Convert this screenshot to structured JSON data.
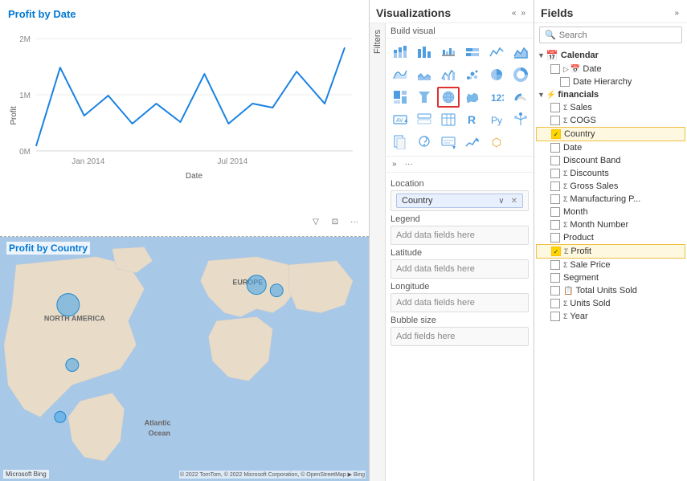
{
  "leftPanel": {
    "chart": {
      "title": "Profit by Date",
      "yLabel": "Profit",
      "xLabel": "Date",
      "xTicks": [
        "Jan 2014",
        "Jul 2014"
      ],
      "yTicks": [
        "2M",
        "1M",
        "0M"
      ]
    },
    "map": {
      "title": "Profit by Country",
      "bingLogo": "Microsoft Bing",
      "copyright": "© 2022 TomTom, © 2022 Microsoft Corporation, © OpenStreetMap ▶ Bing"
    }
  },
  "vizPanel": {
    "title": "Visualizations",
    "filtersLabel": "Filters",
    "buildVisualLabel": "Build visual",
    "tabs": [
      {
        "label": "Build visual",
        "active": true
      }
    ],
    "sections": [
      {
        "label": "Location",
        "fields": [
          {
            "value": "Country",
            "hasChip": true
          }
        ]
      },
      {
        "label": "Legend",
        "fields": [
          {
            "placeholder": "Add data fields here",
            "hasChip": false
          }
        ]
      },
      {
        "label": "Latitude",
        "fields": [
          {
            "placeholder": "Add data fields here",
            "hasChip": false
          }
        ]
      },
      {
        "label": "Longitude",
        "fields": [
          {
            "placeholder": "Add data fields here",
            "hasChip": false
          }
        ]
      },
      {
        "label": "Bubble size",
        "fields": [
          {
            "placeholder": "Add fields here",
            "hasChip": false
          }
        ]
      }
    ]
  },
  "fieldsPanel": {
    "title": "Fields",
    "searchPlaceholder": "Search",
    "groups": [
      {
        "name": "Calendar",
        "icon": "📅",
        "expanded": true,
        "items": [
          {
            "name": "Date",
            "typeIcon": "",
            "checked": false,
            "indent": 1,
            "hasExpand": true
          },
          {
            "name": "Date Hierarchy",
            "typeIcon": "",
            "checked": false,
            "indent": 2
          }
        ]
      },
      {
        "name": "financials",
        "icon": "⚡",
        "expanded": true,
        "items": [
          {
            "name": "Sales",
            "typeIcon": "Σ",
            "checked": false,
            "indent": 1
          },
          {
            "name": "COGS",
            "typeIcon": "Σ",
            "checked": false,
            "indent": 1
          },
          {
            "name": "Country",
            "typeIcon": "",
            "checked": true,
            "indent": 1,
            "highlighted": true
          },
          {
            "name": "Date",
            "typeIcon": "",
            "checked": false,
            "indent": 1
          },
          {
            "name": "Discount Band",
            "typeIcon": "",
            "checked": false,
            "indent": 1
          },
          {
            "name": "Discounts",
            "typeIcon": "Σ",
            "checked": false,
            "indent": 1
          },
          {
            "name": "Gross Sales",
            "typeIcon": "Σ",
            "checked": false,
            "indent": 1
          },
          {
            "name": "Manufacturing P...",
            "typeIcon": "Σ",
            "checked": false,
            "indent": 1
          },
          {
            "name": "Month",
            "typeIcon": "",
            "checked": false,
            "indent": 1
          },
          {
            "name": "Month Number",
            "typeIcon": "Σ",
            "checked": false,
            "indent": 1
          },
          {
            "name": "Product",
            "typeIcon": "",
            "checked": false,
            "indent": 1
          },
          {
            "name": "Profit",
            "typeIcon": "Σ",
            "checked": true,
            "indent": 1,
            "highlighted": true
          },
          {
            "name": "Sale Price",
            "typeIcon": "Σ",
            "checked": false,
            "indent": 1
          },
          {
            "name": "Segment",
            "typeIcon": "",
            "checked": false,
            "indent": 1
          },
          {
            "name": "Total Units Sold",
            "typeIcon": "",
            "checked": false,
            "indent": 1
          },
          {
            "name": "Units Sold",
            "typeIcon": "Σ",
            "checked": false,
            "indent": 1
          },
          {
            "name": "Year",
            "typeIcon": "Σ",
            "checked": false,
            "indent": 1
          }
        ]
      }
    ]
  }
}
